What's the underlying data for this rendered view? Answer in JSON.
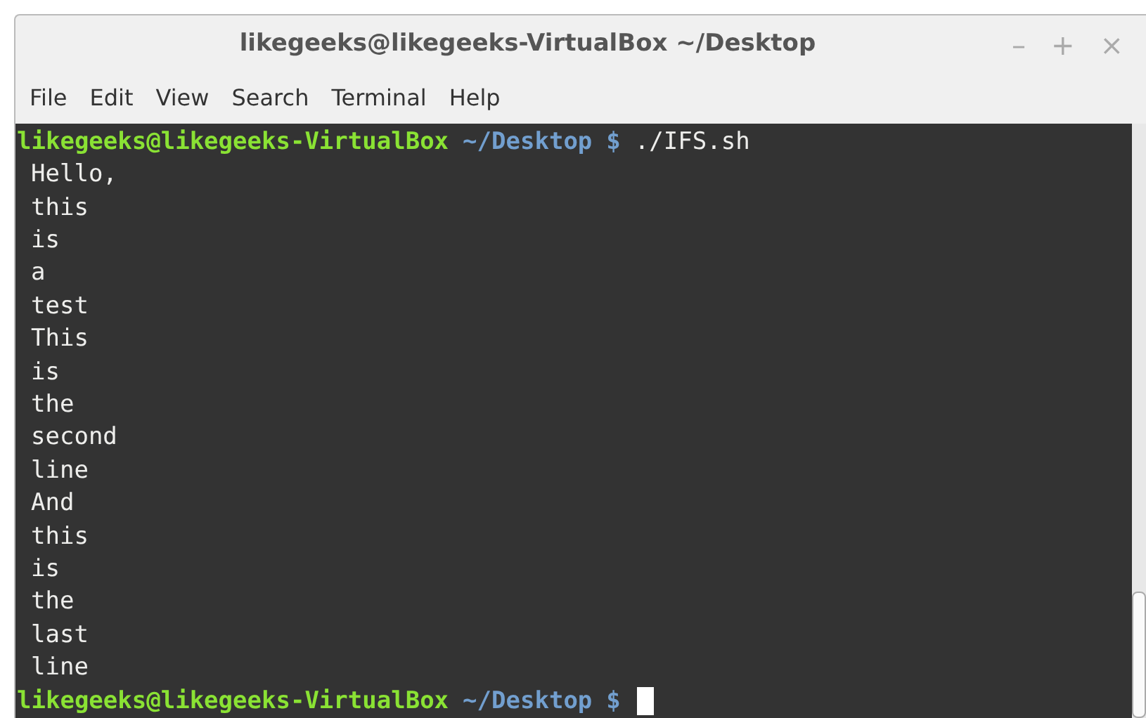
{
  "window": {
    "title": "likegeeks@likegeeks-VirtualBox ~/Desktop",
    "controls": [
      "–",
      "+",
      "×"
    ]
  },
  "menu": [
    "File",
    "Edit",
    "View",
    "Search",
    "Terminal",
    "Help"
  ],
  "terminal": {
    "lines": [
      {
        "kind": "prompt",
        "user": "likegeeks@likegeeks-VirtualBox",
        "path": "~/Desktop",
        "symbol": "$",
        "command": "./IFS.sh",
        "cursor": false
      },
      {
        "kind": "output",
        "text": "Hello,"
      },
      {
        "kind": "output",
        "text": "this"
      },
      {
        "kind": "output",
        "text": "is"
      },
      {
        "kind": "output",
        "text": "a"
      },
      {
        "kind": "output",
        "text": "test"
      },
      {
        "kind": "output",
        "text": "This"
      },
      {
        "kind": "output",
        "text": "is"
      },
      {
        "kind": "output",
        "text": "the"
      },
      {
        "kind": "output",
        "text": "second"
      },
      {
        "kind": "output",
        "text": "line"
      },
      {
        "kind": "output",
        "text": "And"
      },
      {
        "kind": "output",
        "text": "this"
      },
      {
        "kind": "output",
        "text": "is"
      },
      {
        "kind": "output",
        "text": "the"
      },
      {
        "kind": "output",
        "text": "last"
      },
      {
        "kind": "output",
        "text": "line"
      },
      {
        "kind": "prompt",
        "user": "likegeeks@likegeeks-VirtualBox",
        "path": "~/Desktop",
        "symbol": "$",
        "cursor": true
      }
    ]
  }
}
